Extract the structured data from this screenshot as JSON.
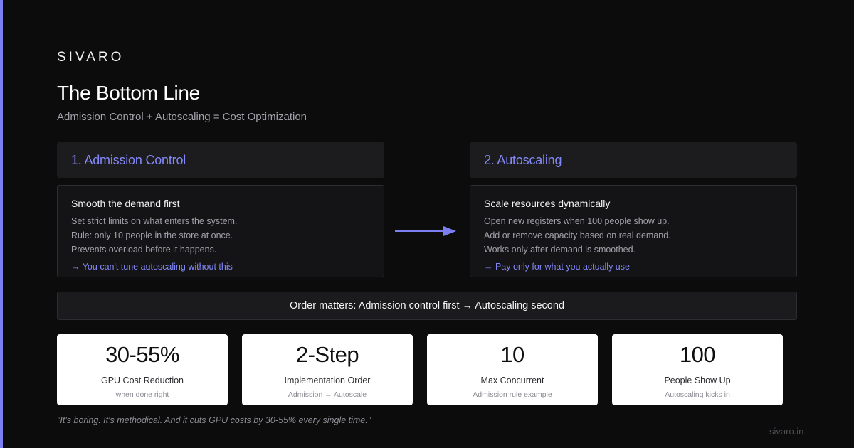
{
  "brand": "SIVARO",
  "title": "The Bottom Line",
  "subtitle": "Admission Control + Autoscaling = Cost Optimization",
  "colors": {
    "background": "#0c0c0d",
    "accent": "#7b7ff2",
    "card": "#ffffff"
  },
  "columns": [
    {
      "header": "1. Admission Control",
      "heading": "Smooth the demand first",
      "lines": [
        "Set strict limits on what enters the system.",
        "Rule: only 10 people in the store at once.",
        "Prevents overload before it happens."
      ],
      "callout": "→ You can't tune autoscaling without this"
    },
    {
      "header": "2. Autoscaling",
      "heading": "Scale resources dynamically",
      "lines": [
        "Open new registers when 100 people show up.",
        "Add or remove capacity based on real demand.",
        "Works only after demand is smoothed."
      ],
      "callout": "→ Pay only for what you actually use"
    }
  ],
  "flow_icon": "arrow-right-icon",
  "order_banner": "Order matters: Admission control first → Autoscaling second",
  "stats": [
    {
      "value": "30-55%",
      "label": "GPU Cost Reduction",
      "note": "when done right"
    },
    {
      "value": "2-Step",
      "label": "Implementation Order",
      "note": "Admission → Autoscale"
    },
    {
      "value": "10",
      "label": "Max Concurrent",
      "note": "Admission rule example"
    },
    {
      "value": "100",
      "label": "People Show Up",
      "note": "Autoscaling kicks in"
    }
  ],
  "quote": "\"It's boring. It's methodical. And it cuts GPU costs by 30-55% every single time.\"",
  "footer_url": "sivaro.in"
}
